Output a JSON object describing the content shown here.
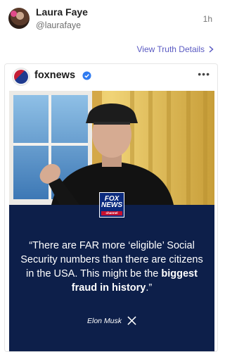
{
  "post": {
    "display_name": "Laura Faye",
    "handle": "@laurafaye",
    "time_ago": "1h",
    "view_details": "View Truth Details"
  },
  "card": {
    "account_name": "foxnews",
    "logo": {
      "line1": "FOX",
      "line2": "NEWS",
      "line3": "channel"
    },
    "quote_parts": [
      "“There are FAR more ‘eligible’ Social Security numbers than there are citizens in the USA. This might be the ",
      "biggest fraud in history",
      ".”"
    ],
    "attribution": "Elon Musk",
    "colors": {
      "panel": "#0d1f4a",
      "accent": "#c8102e",
      "link": "#5a5ac2"
    }
  },
  "icons": {
    "verified": "verified-badge-icon",
    "chevron": "chevron-right-icon",
    "more": "more-horizontal-icon",
    "x_logo": "x-logo-icon"
  }
}
